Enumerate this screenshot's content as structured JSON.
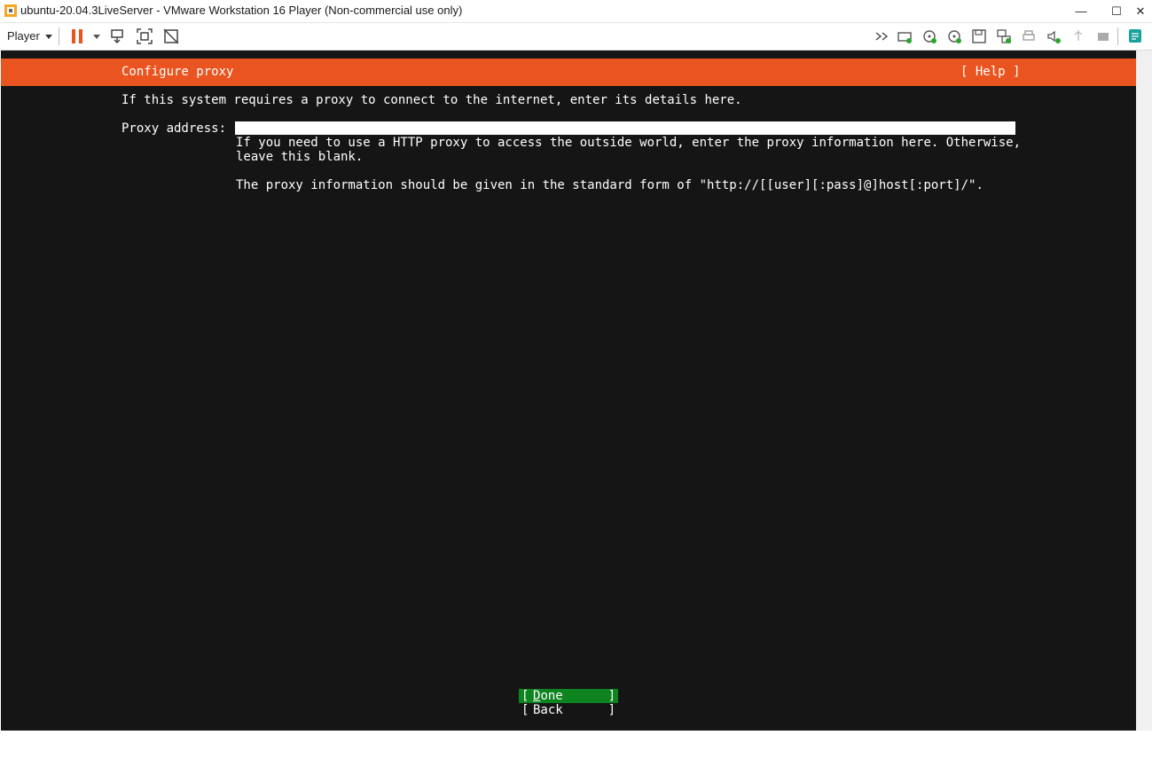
{
  "window": {
    "title": "ubuntu-20.04.3LiveServer - VMware Workstation 16 Player (Non-commercial use only)",
    "minimize": "—",
    "maximize": "☐",
    "close": "✕"
  },
  "toolbar": {
    "player_label": "Player",
    "right_icons": [
      "fast-forward-icon",
      "hard-disk-icon",
      "cd-icon",
      "cd2-icon",
      "floppy-icon",
      "network-icon",
      "printer-icon",
      "sound-icon",
      "usb-icon",
      "printer2-icon",
      "message-icon"
    ]
  },
  "installer": {
    "header_title": "Configure proxy",
    "help_label": "[ Help ]",
    "intro": "If this system requires a proxy to connect to the internet, enter its details here.",
    "proxy_label": "Proxy address:",
    "proxy_value": "",
    "help_line1": "If you need to use a HTTP proxy to access the outside world, enter the proxy information here. Otherwise,",
    "help_line2": "leave this blank.",
    "help_line3": "The proxy information should be given in the standard form of \"http://[[user][:pass]@]host[:port]/\".",
    "done_label": "Done",
    "back_label": "Back",
    "bracket_left": "[",
    "bracket_right": "]"
  },
  "colors": {
    "header": "#e95420",
    "screen_bg": "#151515",
    "done_bg": "#0e8420"
  }
}
